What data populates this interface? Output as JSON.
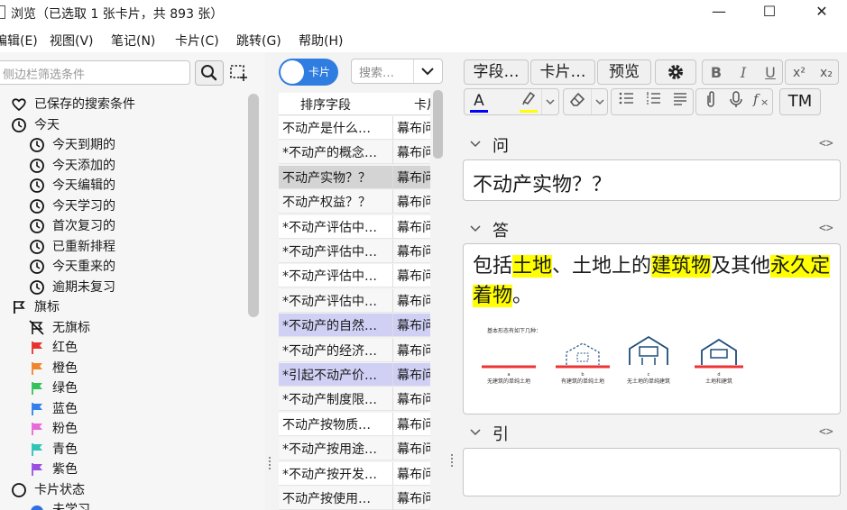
{
  "window": {
    "title": "浏览（已选取 1 张卡片，共 893 张）",
    "minimize": "—",
    "maximize": "☐",
    "close": "✕"
  },
  "menu": [
    "编辑(E)",
    "视图(V)",
    "笔记(N)",
    "卡片(C)",
    "跳转(G)",
    "帮助(H)"
  ],
  "sidebar": {
    "search_placeholder": "侧边栏筛选条件",
    "items": [
      {
        "label": "已保存的搜索条件",
        "icon": "heart-icon"
      },
      {
        "label": "今天",
        "icon": "clock-icon"
      },
      {
        "label": "今天到期的",
        "icon": "clock-icon"
      },
      {
        "label": "今天添加的",
        "icon": "clock-icon"
      },
      {
        "label": "今天编辑的",
        "icon": "clock-icon"
      },
      {
        "label": "今天学习的",
        "icon": "clock-icon"
      },
      {
        "label": "首次复习的",
        "icon": "clock-icon"
      },
      {
        "label": "已重新排程",
        "icon": "clock-icon"
      },
      {
        "label": "今天重来的",
        "icon": "clock-icon"
      },
      {
        "label": "逾期未复习",
        "icon": "clock-icon"
      },
      {
        "label": "旗标",
        "icon": "flag-outline-icon"
      },
      {
        "label": "无旗标",
        "icon": "flag-off-icon"
      },
      {
        "label": "红色",
        "icon": "flag-icon"
      },
      {
        "label": "橙色",
        "icon": "flag-icon"
      },
      {
        "label": "绿色",
        "icon": "flag-icon"
      },
      {
        "label": "蓝色",
        "icon": "flag-icon"
      },
      {
        "label": "粉色",
        "icon": "flag-icon"
      },
      {
        "label": "青色",
        "icon": "flag-icon"
      },
      {
        "label": "紫色",
        "icon": "flag-icon"
      },
      {
        "label": "卡片状态",
        "icon": "circle-icon"
      },
      {
        "label": "未学习",
        "icon": "circle-filled-icon"
      }
    ],
    "flag_colors": [
      "#e8322e",
      "#f0852f",
      "#35c25a",
      "#2f80ed",
      "#e86ad8",
      "#2ec4b6",
      "#9b4fe0"
    ]
  },
  "browser": {
    "toggle_label": "卡片",
    "search_placeholder": "搜索…",
    "columns": [
      "排序字段",
      "卡片"
    ],
    "rows": [
      {
        "sort": "不动产是什么…",
        "card": "幕布问"
      },
      {
        "sort": "*不动产的概念…",
        "card": "幕布问"
      },
      {
        "sort": "不动产实物？？",
        "card": "幕布问"
      },
      {
        "sort": "不动产权益？？",
        "card": "幕布问"
      },
      {
        "sort": "*不动产评估中…",
        "card": "幕布问"
      },
      {
        "sort": "*不动产评估中…",
        "card": "幕布问"
      },
      {
        "sort": "*不动产评估中…",
        "card": "幕布问"
      },
      {
        "sort": "*不动产评估中…",
        "card": "幕布问"
      },
      {
        "sort": "*不动产的自然…",
        "card": "幕布问"
      },
      {
        "sort": "*不动产的经济…",
        "card": "幕布问"
      },
      {
        "sort": "*引起不动产价…",
        "card": "幕布问"
      },
      {
        "sort": "*不动产制度限…",
        "card": "幕布问"
      },
      {
        "sort": "不动产按物质…",
        "card": "幕布问"
      },
      {
        "sort": "*不动产按用途…",
        "card": "幕布问"
      },
      {
        "sort": "*不动产按开发…",
        "card": "幕布问"
      },
      {
        "sort": "不动产按使用…",
        "card": "幕布问"
      }
    ],
    "row_states": [
      "",
      "",
      "selected",
      "",
      "",
      "",
      "",
      "",
      "marked",
      "",
      "marked",
      "",
      "",
      "",
      "",
      ""
    ]
  },
  "editor": {
    "toolbar": {
      "fields_button": "字段…",
      "cards_button": "卡片…",
      "preview_button": "预览"
    },
    "format": {
      "bold": "B",
      "italic": "I",
      "underline": "U",
      "superscript": "x²",
      "subscript": "x₂",
      "text_color": "A",
      "mathjax": "TM"
    },
    "fields": [
      {
        "name": "问",
        "content": "不动产实物？？"
      },
      {
        "name": "答"
      },
      {
        "name": "引",
        "content": ""
      }
    ],
    "answer": {
      "p1": "包括",
      "h1": "土地",
      "p2": "、土地上的",
      "h2": "建筑物",
      "p3": "及其他",
      "h3": "永久定着物",
      "p4": "。"
    },
    "diagram": {
      "caption": "基本形态有如下几种：",
      "letters": [
        "a",
        "b",
        "c",
        "d"
      ],
      "labels": [
        "无建筑的单纯土地",
        "有建筑的单纯土地",
        "无土地的单纯建筑",
        "土地和建筑"
      ]
    },
    "code_toggle": "<>"
  }
}
